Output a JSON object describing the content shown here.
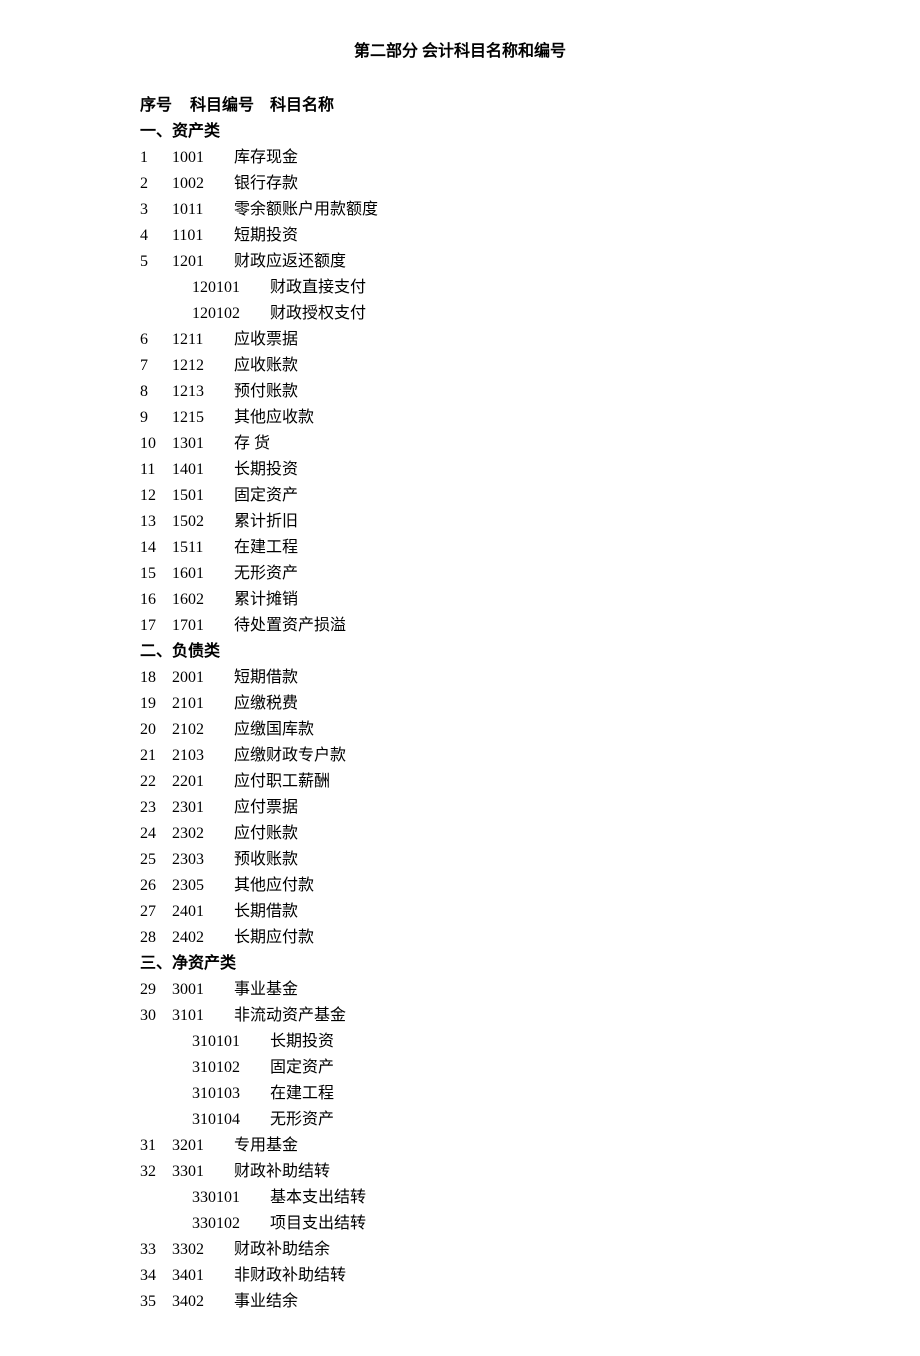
{
  "title": "第二部分 会计科目名称和编号",
  "headers": {
    "seq": "序号",
    "code": "科目编号",
    "name": "科目名称"
  },
  "sections": [
    {
      "label": "一、资产类",
      "items": [
        {
          "seq": "1",
          "code": "1001",
          "name": "库存现金"
        },
        {
          "seq": "2",
          "code": "1002",
          "name": "银行存款"
        },
        {
          "seq": "3",
          "code": "1011",
          "name": "零余额账户用款额度"
        },
        {
          "seq": "4",
          "code": "1101",
          "name": "短期投资"
        },
        {
          "seq": "5",
          "code": "1201",
          "name": "财政应返还额度",
          "subs": [
            {
              "code": "120101",
              "name": "财政直接支付"
            },
            {
              "code": "120102",
              "name": "财政授权支付"
            }
          ]
        },
        {
          "seq": "6",
          "code": "1211",
          "name": "应收票据"
        },
        {
          "seq": "7",
          "code": "1212",
          "name": "应收账款"
        },
        {
          "seq": "8",
          "code": "1213",
          "name": "预付账款"
        },
        {
          "seq": "9",
          "code": "1215",
          "name": "其他应收款"
        },
        {
          "seq": "10",
          "code": "1301",
          "name": "存 货"
        },
        {
          "seq": "11",
          "code": "1401",
          "name": "长期投资"
        },
        {
          "seq": "12",
          "code": "1501",
          "name": "固定资产"
        },
        {
          "seq": "13",
          "code": "1502",
          "name": "累计折旧"
        },
        {
          "seq": "14",
          "code": "1511",
          "name": "在建工程"
        },
        {
          "seq": "15",
          "code": "1601",
          "name": "无形资产"
        },
        {
          "seq": "16",
          "code": "1602",
          "name": "累计摊销"
        },
        {
          "seq": "17",
          "code": "1701",
          "name": "待处置资产损溢"
        }
      ]
    },
    {
      "label": "二、负债类",
      "items": [
        {
          "seq": "18",
          "code": "2001",
          "name": "短期借款"
        },
        {
          "seq": "19",
          "code": "2101",
          "name": "应缴税费"
        },
        {
          "seq": "20",
          "code": "2102",
          "name": "应缴国库款"
        },
        {
          "seq": "21",
          "code": "2103",
          "name": "应缴财政专户款"
        },
        {
          "seq": "22",
          "code": "2201",
          "name": "应付职工薪酬"
        },
        {
          "seq": "23",
          "code": "2301",
          "name": "应付票据"
        },
        {
          "seq": "24",
          "code": "2302",
          "name": "应付账款"
        },
        {
          "seq": "25",
          "code": "2303",
          "name": "预收账款"
        },
        {
          "seq": "26",
          "code": "2305",
          "name": "其他应付款"
        },
        {
          "seq": "27",
          "code": "2401",
          "name": "长期借款"
        },
        {
          "seq": "28",
          "code": "2402",
          "name": "长期应付款"
        }
      ]
    },
    {
      "label": "三、净资产类",
      "items": [
        {
          "seq": "29",
          "code": "3001",
          "name": "事业基金"
        },
        {
          "seq": "30",
          "code": "3101",
          "name": "非流动资产基金",
          "subs": [
            {
              "code": "310101",
              "name": "长期投资"
            },
            {
              "code": "310102",
              "name": "固定资产"
            },
            {
              "code": "310103",
              "name": "在建工程"
            },
            {
              "code": "310104",
              "name": "无形资产"
            }
          ]
        },
        {
          "seq": "31",
          "code": "3201",
          "name": "专用基金"
        },
        {
          "seq": "32",
          "code": "3301",
          "name": "财政补助结转",
          "subs": [
            {
              "code": "330101",
              "name": "基本支出结转"
            },
            {
              "code": "330102",
              "name": "项目支出结转"
            }
          ]
        },
        {
          "seq": "33",
          "code": "3302",
          "name": "财政补助结余"
        },
        {
          "seq": "34",
          "code": "3401",
          "name": "非财政补助结转"
        },
        {
          "seq": "35",
          "code": "3402",
          "name": "事业结余"
        }
      ]
    }
  ]
}
